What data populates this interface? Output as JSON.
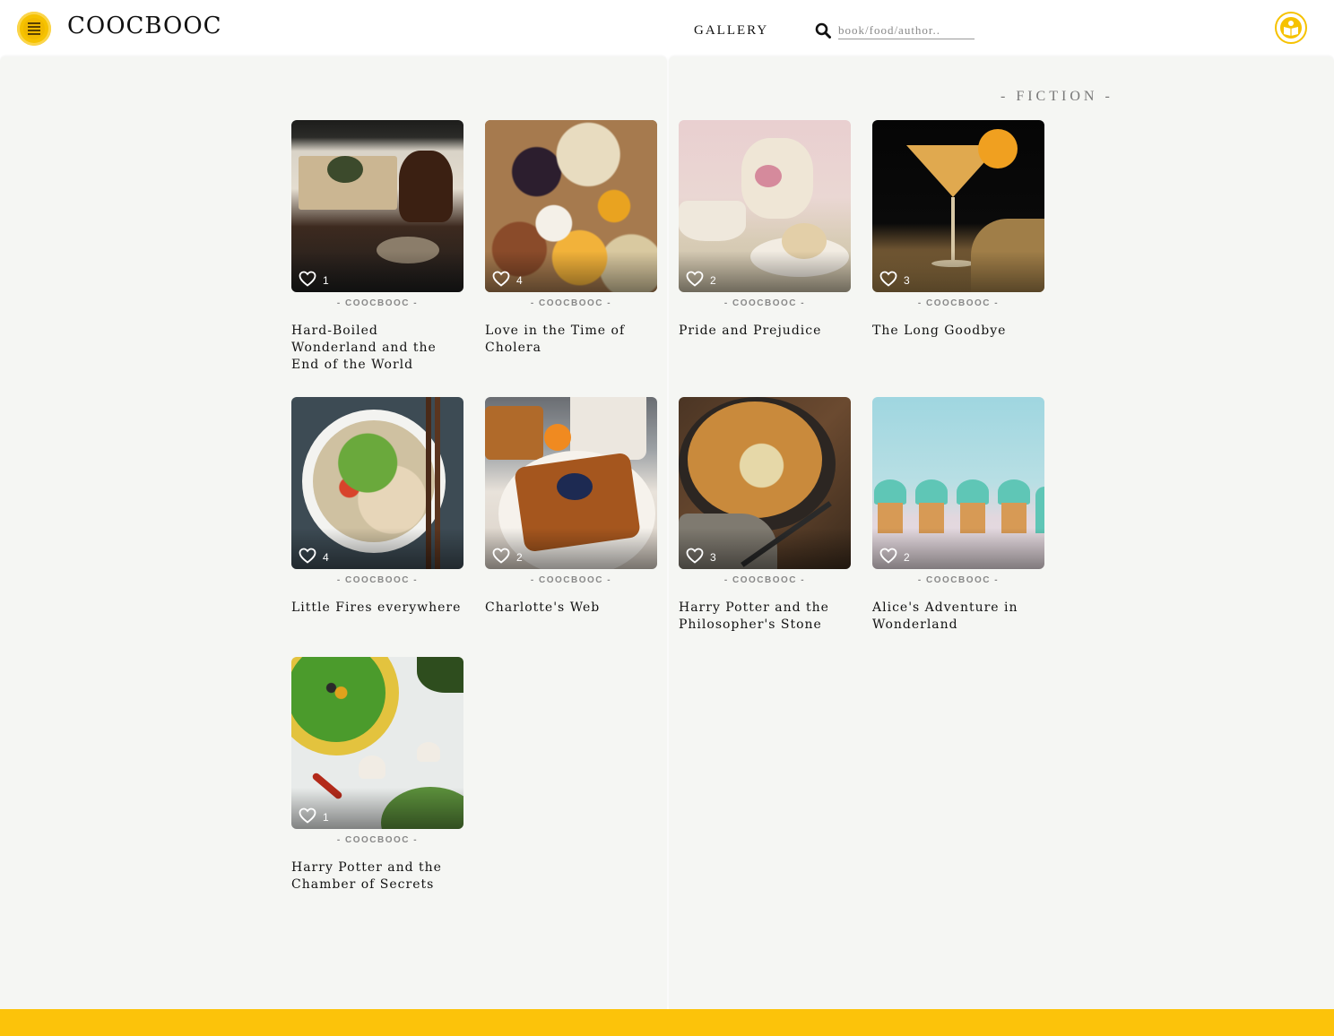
{
  "header": {
    "brand": "COOCBOOC",
    "nav_gallery": "GALLERY",
    "search_placeholder": "book/food/author.."
  },
  "colors": {
    "accent": "#fcc30a",
    "panel_bg": "#f5f6f3",
    "text": "#111111",
    "muted": "#888888"
  },
  "section": {
    "title": "- FICTION -"
  },
  "cards": [
    {
      "likes": "1",
      "by": "- COOCBOOC -",
      "title": "Hard-Boiled Wonderland and the End of the World"
    },
    {
      "likes": "4",
      "by": "- COOCBOOC -",
      "title": "Love in the Time of Cholera"
    },
    {
      "likes": "2",
      "by": "- COOCBOOC -",
      "title": "Pride and Prejudice"
    },
    {
      "likes": "3",
      "by": "- COOCBOOC -",
      "title": "The Long Goodbye"
    },
    {
      "likes": "4",
      "by": "- COOCBOOC -",
      "title": "Little Fires everywhere"
    },
    {
      "likes": "2",
      "by": "- COOCBOOC -",
      "title": "Charlotte's Web"
    },
    {
      "likes": "3",
      "by": "- COOCBOOC -",
      "title": "Harry Potter and the Philosopher's Stone"
    },
    {
      "likes": "2",
      "by": "- COOCBOOC -",
      "title": "Alice's Adventure in Wonderland"
    },
    {
      "likes": "1",
      "by": "- COOCBOOC -",
      "title": "Harry Potter and the Chamber of Secrets"
    }
  ]
}
